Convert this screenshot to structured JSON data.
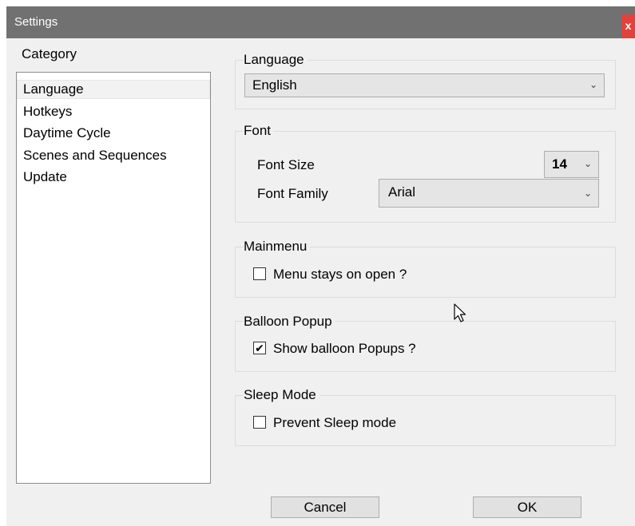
{
  "window": {
    "title": "Settings",
    "close_label": "x"
  },
  "category": {
    "label": "Category",
    "items": [
      "Language",
      "Hotkeys",
      "Daytime Cycle",
      "Scenes and Sequences",
      "Update"
    ],
    "selected": "Language"
  },
  "language": {
    "title": "Language",
    "value": "English"
  },
  "font": {
    "title": "Font",
    "size_label": "Font Size",
    "size_value": "14",
    "family_label": "Font Family",
    "family_value": "Arial"
  },
  "mainmenu": {
    "title": "Mainmenu",
    "checkbox_label": "Menu stays on open ?",
    "checked": false
  },
  "balloon": {
    "title": "Balloon Popup",
    "checkbox_label": "Show balloon Popups ?",
    "checked": true
  },
  "sleep": {
    "title": "Sleep Mode",
    "checkbox_label": "Prevent Sleep mode",
    "checked": false
  },
  "buttons": {
    "cancel": "Cancel",
    "ok": "OK"
  },
  "icons": {
    "dropdown": "chevron-down-icon",
    "check": "checkmark-icon",
    "close": "close-icon",
    "cursor": "mouse-pointer-icon"
  },
  "colors": {
    "titlebar": "#717171",
    "close_button": "#e0433c",
    "window_bg": "#f0f0f0"
  }
}
